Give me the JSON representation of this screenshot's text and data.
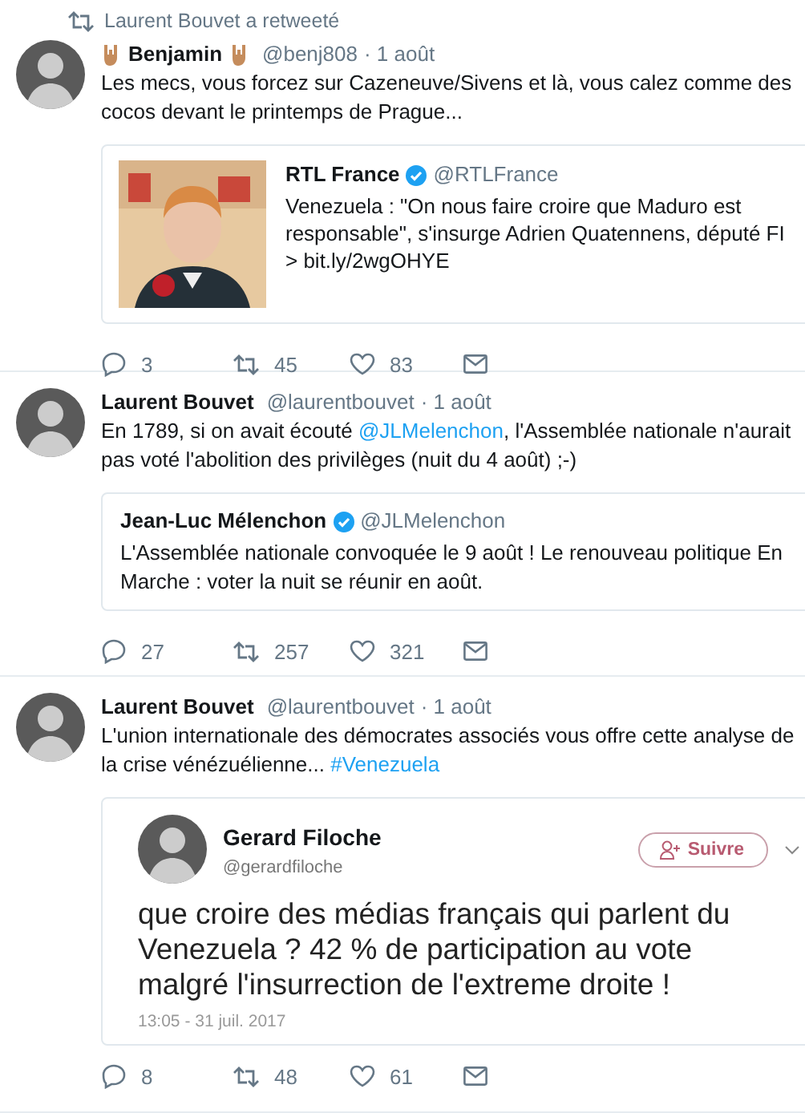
{
  "retweet_note": "Laurent Bouvet a retweeté",
  "tweets": [
    {
      "name": "Benjamin",
      "hand_icons": true,
      "handle": "@benj808",
      "date": "· 1 août",
      "text": [
        {
          "text": "Les mecs, vous forcez sur Cazeneuve/Sivens et là, vous calez comme des cocos devant le printemps de Prague...",
          "link": false
        }
      ],
      "quote": {
        "kind": "card",
        "name": "RTL France",
        "verified": true,
        "handle": "@RTLFrance",
        "text": "Venezuela : \"On nous faire croire que Maduro est responsable\", s'insurge Adrien Quatennens, député FI > bit.ly/2wgOHYE"
      },
      "counts": {
        "replies": "3",
        "retweets": "45",
        "likes": "83"
      }
    },
    {
      "name": "Laurent Bouvet",
      "hand_icons": false,
      "handle": "@laurentbouvet",
      "date": "· 1 août",
      "text": [
        {
          "text": "En 1789, si on avait écouté ",
          "link": false
        },
        {
          "text": "@JLMelenchon",
          "link": true
        },
        {
          "text": ", l'Assemblée nationale n'aurait pas voté l'abolition des privilèges (nuit du 4 août) ;-)",
          "link": false
        }
      ],
      "quote": {
        "kind": "quote",
        "name": "Jean-Luc Mélenchon",
        "verified": true,
        "handle": "@JLMelenchon",
        "text": "L'Assemblée nationale convoquée le 9 août ! Le renouveau politique En Marche : voter la nuit se réunir en août."
      },
      "counts": {
        "replies": "27",
        "retweets": "257",
        "likes": "321"
      }
    },
    {
      "name": "Laurent Bouvet",
      "hand_icons": false,
      "handle": "@laurentbouvet",
      "date": "· 1 août",
      "text": [
        {
          "text": "L'union internationale des démocrates associés vous offre cette analyse de la crise vénézuélienne... ",
          "link": false
        },
        {
          "text": "#Venezuela",
          "link": true
        }
      ],
      "quote": {
        "kind": "screenshot",
        "name": "Gerard Filoche",
        "verified": false,
        "handle": "@gerardfiloche",
        "follow": "Suivre",
        "text": "que croire des médias français qui parlent du Venezuela ? 42 % de participation au vote malgré l'insurrection de l'extreme droite !",
        "timestamp": "13:05 - 31 juil. 2017"
      },
      "counts": {
        "replies": "8",
        "retweets": "48",
        "likes": "61"
      }
    }
  ]
}
